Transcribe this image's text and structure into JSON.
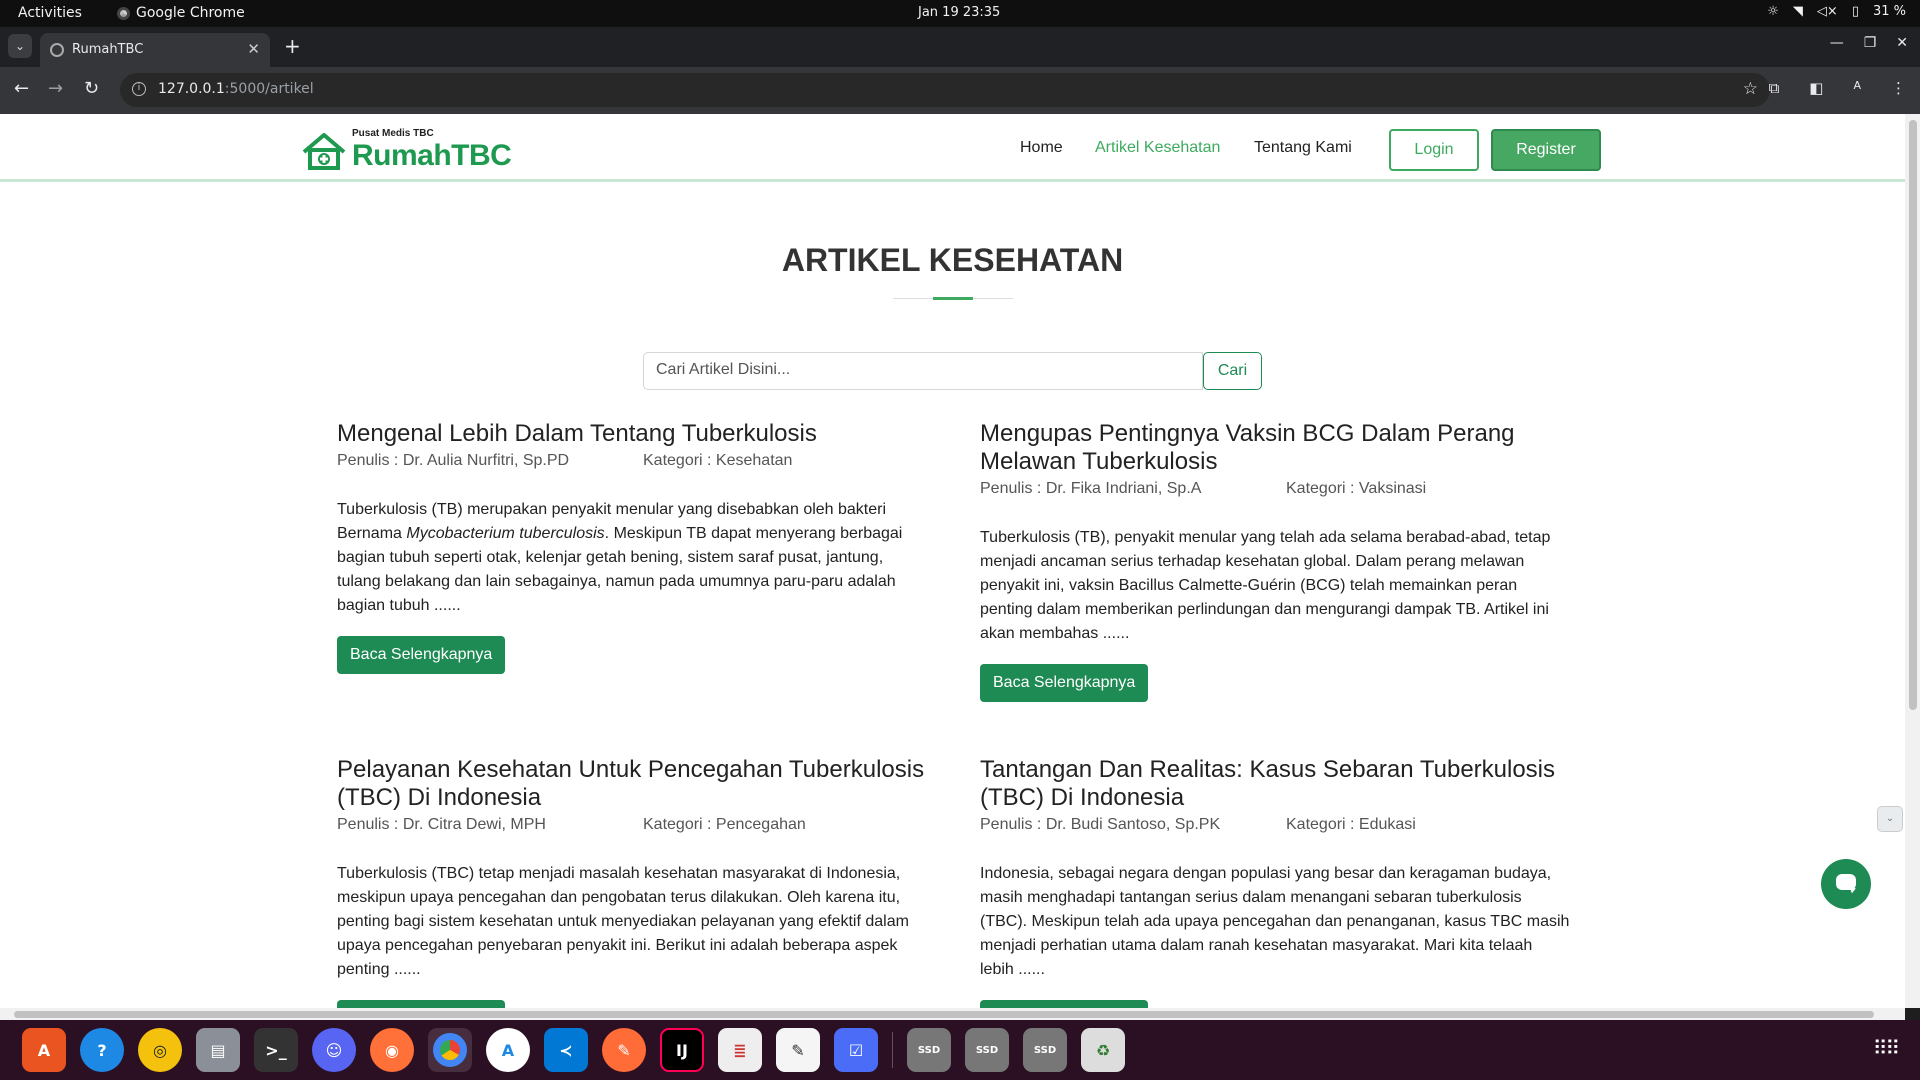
{
  "system": {
    "activities": "Activities",
    "app_name": "Google Chrome",
    "clock": "Jan 19  23:35",
    "battery": "31 %"
  },
  "browser": {
    "tab_title": "RumahTBC",
    "url_host": "127.0.0.1",
    "url_rest": ":5000/artikel",
    "profile_initial": "A"
  },
  "site": {
    "logo_tagline": "Pusat Medis TBC",
    "logo_brand": "RumahTBC",
    "nav": [
      {
        "label": "Home"
      },
      {
        "label": "Artikel Kesehatan"
      },
      {
        "label": "Tentang Kami"
      }
    ],
    "login_label": "Login",
    "register_label": "Register",
    "heading": "ARTIKEL KESEHATAN",
    "search": {
      "placeholder": "Cari Artikel Disini...",
      "button": "Cari"
    },
    "read_more_label": "Baca Selengkapnya",
    "articles": [
      {
        "title": "Mengenal Lebih Dalam Tentang Tuberkulosis",
        "author": "Penulis : Dr. Aulia Nurfitri, Sp.PD",
        "category": "Kategori : Kesehatan",
        "excerpt_pre": "Tuberkulosis (TB) merupakan penyakit menular yang disebabkan oleh bakteri Bernama ",
        "excerpt_em": "Mycobacterium tuberculosis",
        "excerpt_post": ". Meskipun TB dapat menyerang berbagai bagian tubuh seperti otak, kelenjar getah bening, sistem saraf pusat, jantung, tulang belakang dan lain sebagainya, namun pada umumnya paru-paru adalah bagian tubuh ......"
      },
      {
        "title": "Mengupas Pentingnya Vaksin BCG Dalam Perang Melawan Tuberkulosis",
        "author": "Penulis : Dr. Fika Indriani, Sp.A",
        "category": "Kategori : Vaksinasi",
        "excerpt": "Tuberkulosis (TB), penyakit menular yang telah ada selama berabad-abad, tetap menjadi ancaman serius terhadap kesehatan global. Dalam perang melawan penyakit ini, vaksin Bacillus Calmette-Guérin (BCG) telah memainkan peran penting dalam memberikan perlindungan dan mengurangi dampak TB. Artikel ini akan membahas ......"
      },
      {
        "title": "Pelayanan Kesehatan Untuk Pencegahan Tuberkulosis (TBC) Di Indonesia",
        "author": "Penulis : Dr. Citra Dewi, MPH",
        "category": "Kategori : Pencegahan",
        "excerpt": "Tuberkulosis (TBC) tetap menjadi masalah kesehatan masyarakat di Indonesia, meskipun upaya pencegahan dan pengobatan terus dilakukan. Oleh karena itu, penting bagi sistem kesehatan untuk menyediakan pelayanan yang efektif dalam upaya pencegahan penyebaran penyakit ini. Berikut ini adalah beberapa aspek penting ......"
      },
      {
        "title": "Tantangan Dan Realitas: Kasus Sebaran Tuberkulosis (TBC) Di Indonesia",
        "author": "Penulis : Dr. Budi Santoso, Sp.PK",
        "category": "Kategori : Edukasi",
        "excerpt": "Indonesia, sebagai negara dengan populasi yang besar dan keragaman budaya, masih menghadapi tantangan serius dalam menangani sebaran tuberkulosis (TBC). Meskipun telah ada upaya pencegahan dan penanganan, kasus TBC masih menjadi perhatian utama dalam ranah kesehatan masyarakat. Mari kita telaah lebih ......"
      }
    ]
  },
  "colors": {
    "brand_green": "#3eaa5f",
    "button_green": "#1e8a54"
  },
  "dock_apps": [
    "app-center",
    "help",
    "rhythmbox",
    "files",
    "terminal",
    "discord",
    "firefox",
    "chrome",
    "app-store",
    "vscode",
    "postman",
    "intellij",
    "document-viewer",
    "text-editor",
    "tasks",
    "ssd-1",
    "ssd-2",
    "ssd-3",
    "trash"
  ]
}
